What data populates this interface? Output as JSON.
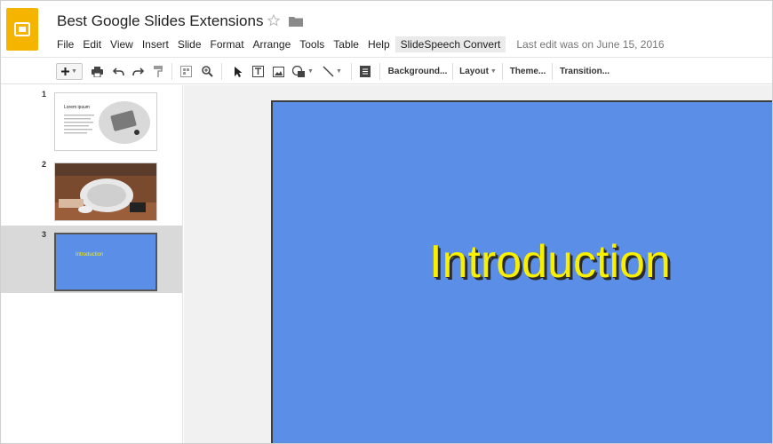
{
  "app": {
    "title": "Best Google Slides Extensions",
    "last_edit": "Last edit was on June 15, 2016"
  },
  "menu": [
    "File",
    "Edit",
    "View",
    "Insert",
    "Slide",
    "Format",
    "Arrange",
    "Tools",
    "Table",
    "Help",
    "SlideSpeech Convert"
  ],
  "toolbar": {
    "icons": [
      "plus-icon",
      "print-icon",
      "undo-icon",
      "redo-icon",
      "paint-format-icon",
      "layout-grid-icon",
      "zoom-icon",
      "select-cursor-icon",
      "text-box-icon",
      "image-icon",
      "shape-icon",
      "line-icon",
      "comment-icon"
    ],
    "background_label": "Background...",
    "layout_label": "Layout",
    "theme_label": "Theme...",
    "transition_label": "Transition..."
  },
  "slides": [
    {
      "number": "1",
      "title": "Lorem ipsum"
    },
    {
      "number": "2"
    },
    {
      "number": "3",
      "title": "Introduction",
      "active": true
    }
  ],
  "current_slide": {
    "title": "Introduction",
    "background": "#5b8ee6",
    "title_color": "#f9f000"
  },
  "colors": {
    "brand": "#f4b400",
    "active_slide_bg": "#d9d9d9"
  }
}
